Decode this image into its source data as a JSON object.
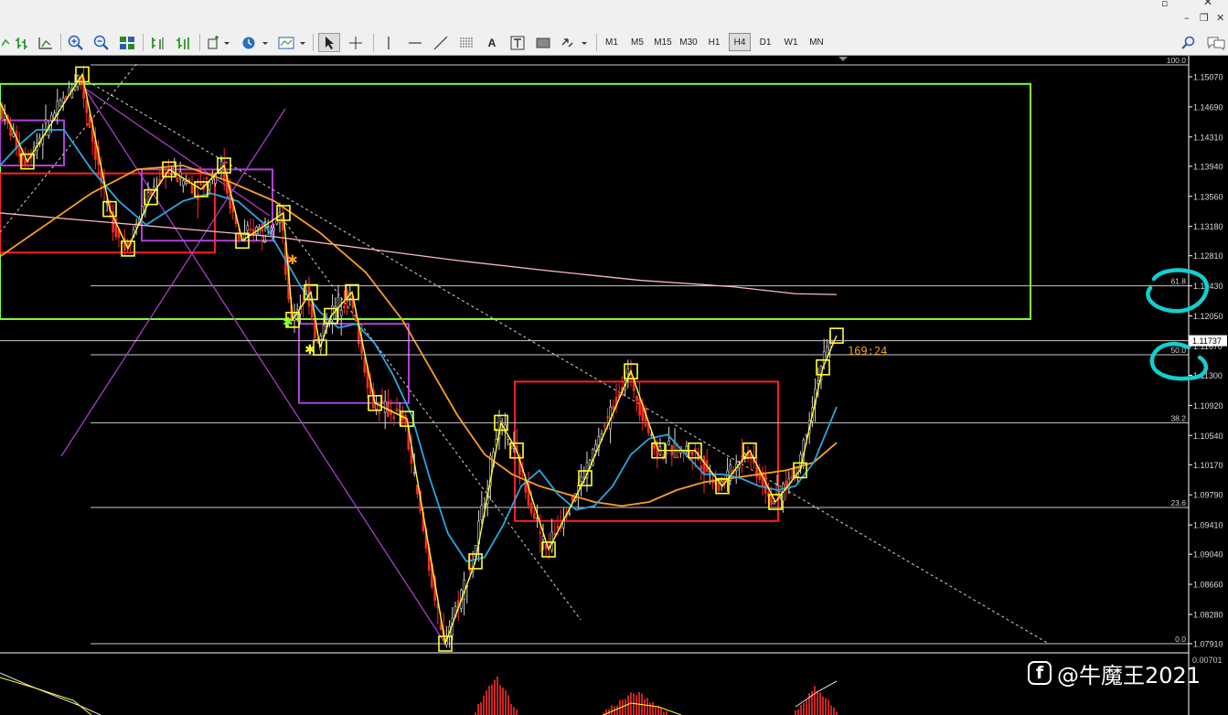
{
  "window": {
    "min_icon": "minimize-icon",
    "restore_icon": "restore-icon",
    "close_icon": "close-icon"
  },
  "toolbar": {
    "timeframes": [
      "M1",
      "M5",
      "M15",
      "M30",
      "H1",
      "H4",
      "D1",
      "W1",
      "MN"
    ],
    "active_timeframe": "H4",
    "tools": [
      "line-chart-icon",
      "bar-chart-icon",
      "candle-chart-icon",
      "zoom-in-icon",
      "zoom-out-icon",
      "tile-windows-icon",
      "chart-shift-icon",
      "autoscroll-icon",
      "indicators-icon",
      "periods-icon",
      "templates-icon",
      "cursor-icon",
      "crosshair-icon",
      "vertical-line-icon",
      "horizontal-line-icon",
      "trendline-icon",
      "channel-icon",
      "text-icon",
      "text-label-icon",
      "rectangle-icon",
      "arrows-icon"
    ],
    "text_tool_label": "A",
    "search_icon": "search-icon",
    "chat_icon": "chat-icon"
  },
  "price_axis": {
    "ticks": [
      "1.15070",
      "1.14690",
      "1.14310",
      "1.13940",
      "1.13560",
      "1.13180",
      "1.12810",
      "1.12430",
      "1.12050",
      "1.11670",
      "1.11300",
      "1.10920",
      "1.10540",
      "1.10170",
      "1.09790",
      "1.09410",
      "1.09040",
      "1.08660",
      "1.08280",
      "1.07910"
    ],
    "current_price": "1.11737",
    "macd_top": "0.00701"
  },
  "fibonacci": [
    {
      "label": "100.0",
      "price": 1.1522
    },
    {
      "label": "61.8",
      "price": 1.1243
    },
    {
      "label": "50.0",
      "price": 1.1156
    },
    {
      "label": "38.2",
      "price": 1.107
    },
    {
      "label": "23.6",
      "price": 1.0963
    },
    {
      "label": "0.0",
      "price": 1.0791
    }
  ],
  "timer": "169:24",
  "watermark": "@牛魔王2021",
  "colors": {
    "fib": "#c8c8c8",
    "fast_ma": "#29a7e1",
    "slow_ma": "#ff9e20",
    "long_ma": "#ffb6c8",
    "zone_green": "#7cff3c",
    "zone_red": "#ff2020",
    "zone_purple": "#b040d8",
    "zigzag": "#ffff30",
    "circle": "#10d0d0",
    "timer": "#e8a020"
  },
  "chart_data": {
    "type": "candlestick",
    "symbol": "",
    "timeframe": "H4",
    "ylim": [
      1.0791,
      1.1525
    ],
    "current_price": 1.11737,
    "fast_ma_path": [
      [
        0,
        1.1395
      ],
      [
        20,
        1.142
      ],
      [
        40,
        1.144
      ],
      [
        70,
        1.144
      ],
      [
        100,
        1.139
      ],
      [
        130,
        1.135
      ],
      [
        160,
        1.132
      ],
      [
        200,
        1.135
      ],
      [
        230,
        1.136
      ],
      [
        260,
        1.135
      ],
      [
        290,
        1.132
      ],
      [
        310,
        1.128
      ],
      [
        330,
        1.124
      ],
      [
        350,
        1.121
      ],
      [
        370,
        1.119
      ],
      [
        390,
        1.1195
      ],
      [
        410,
        1.117
      ],
      [
        430,
        1.113
      ],
      [
        450,
        1.108
      ],
      [
        470,
        1.1
      ],
      [
        490,
        1.093
      ],
      [
        510,
        1.0895
      ],
      [
        530,
        1.09
      ],
      [
        550,
        1.094
      ],
      [
        570,
        1.099
      ],
      [
        590,
        1.101
      ],
      [
        610,
        1.098
      ],
      [
        630,
        1.096
      ],
      [
        650,
        1.0965
      ],
      [
        670,
        1.099
      ],
      [
        690,
        1.103
      ],
      [
        710,
        1.105
      ],
      [
        730,
        1.1055
      ],
      [
        750,
        1.103
      ],
      [
        770,
        1.1005
      ],
      [
        790,
        1.1005
      ],
      [
        810,
        1.1
      ],
      [
        830,
        1.099
      ],
      [
        850,
        1.0985
      ],
      [
        870,
        1.099
      ],
      [
        890,
        1.102
      ],
      [
        915,
        1.109
      ]
    ],
    "slow_ma_path": [
      [
        0,
        1.128
      ],
      [
        50,
        1.132
      ],
      [
        100,
        1.136
      ],
      [
        150,
        1.139
      ],
      [
        200,
        1.1395
      ],
      [
        250,
        1.1375
      ],
      [
        300,
        1.135
      ],
      [
        350,
        1.131
      ],
      [
        400,
        1.126
      ],
      [
        440,
        1.12
      ],
      [
        470,
        1.114
      ],
      [
        500,
        1.108
      ],
      [
        530,
        1.103
      ],
      [
        560,
        1.1005
      ],
      [
        590,
        1.099
      ],
      [
        620,
        1.098
      ],
      [
        650,
        1.097
      ],
      [
        680,
        1.0965
      ],
      [
        710,
        1.097
      ],
      [
        740,
        1.0985
      ],
      [
        770,
        1.0995
      ],
      [
        800,
        1.1
      ],
      [
        830,
        1.1005
      ],
      [
        860,
        1.101
      ],
      [
        890,
        1.102
      ],
      [
        915,
        1.1045
      ]
    ],
    "long_ma_path": [
      [
        0,
        1.1335
      ],
      [
        100,
        1.1325
      ],
      [
        200,
        1.1315
      ],
      [
        300,
        1.1305
      ],
      [
        400,
        1.129
      ],
      [
        500,
        1.1275
      ],
      [
        600,
        1.1262
      ],
      [
        700,
        1.125
      ],
      [
        800,
        1.1242
      ],
      [
        870,
        1.1233
      ],
      [
        915,
        1.1232
      ]
    ],
    "zones": [
      {
        "color": "green",
        "from": [
          0,
          1.1498
        ],
        "to": [
          1127,
          1.1201
        ]
      },
      {
        "color": "red",
        "from": [
          0,
          1.1385
        ],
        "to": [
          235,
          1.1285
        ]
      },
      {
        "color": "purple",
        "from": [
          0,
          1.1452
        ],
        "to": [
          70,
          1.1395
        ]
      },
      {
        "color": "purple",
        "from": [
          155,
          1.139
        ],
        "to": [
          298,
          1.13
        ]
      },
      {
        "color": "purple",
        "from": [
          327,
          1.1195
        ],
        "to": [
          447,
          1.1095
        ]
      },
      {
        "color": "red",
        "from": [
          563,
          1.1122
        ],
        "to": [
          851,
          1.0946
        ]
      }
    ],
    "zigzag_path": [
      [
        0,
        1.1475
      ],
      [
        30,
        1.14
      ],
      [
        90,
        1.151
      ],
      [
        120,
        1.134
      ],
      [
        140,
        1.129
      ],
      [
        165,
        1.1355
      ],
      [
        185,
        1.139
      ],
      [
        220,
        1.1365
      ],
      [
        245,
        1.1395
      ],
      [
        265,
        1.13
      ],
      [
        310,
        1.1335
      ],
      [
        320,
        1.12
      ],
      [
        340,
        1.1235
      ],
      [
        350,
        1.1165
      ],
      [
        362,
        1.1205
      ],
      [
        385,
        1.1235
      ],
      [
        410,
        1.1095
      ],
      [
        445,
        1.1075
      ],
      [
        487,
        1.0791
      ],
      [
        520,
        1.0895
      ],
      [
        548,
        1.107
      ],
      [
        565,
        1.1035
      ],
      [
        600,
        1.091
      ],
      [
        640,
        1.1
      ],
      [
        690,
        1.1135
      ],
      [
        720,
        1.1035
      ],
      [
        760,
        1.1035
      ],
      [
        790,
        1.099
      ],
      [
        820,
        1.1035
      ],
      [
        848,
        1.097
      ],
      [
        875,
        1.101
      ],
      [
        900,
        1.114
      ],
      [
        915,
        1.118
      ]
    ]
  }
}
